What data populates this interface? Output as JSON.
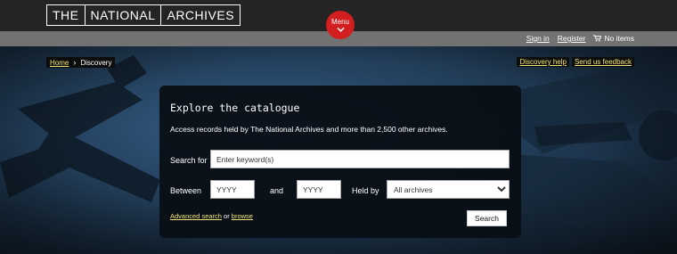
{
  "header": {
    "logo": [
      "THE",
      "NATIONAL",
      "ARCHIVES"
    ],
    "menu_label": "Menu"
  },
  "userbar": {
    "sign_in": "Sign in",
    "register": "Register",
    "cart": "No items"
  },
  "breadcrumb": {
    "home": "Home",
    "current": "Discovery"
  },
  "help_links": {
    "discovery_help": "Discovery help",
    "feedback": "Send us feedback"
  },
  "search_panel": {
    "title": "Explore the catalogue",
    "intro": "Access records held by The National Archives and more than 2,500 other archives.",
    "search_label": "Search for",
    "search_placeholder": "Enter keyword(s)",
    "between_label": "Between",
    "from_placeholder": "YYYY",
    "and_label": "and",
    "to_placeholder": "YYYY",
    "held_by_label": "Held by",
    "held_by_selected": "All archives",
    "advanced_search": "Advanced search",
    "or_text": " or ",
    "browse": "browse",
    "search_button": "Search"
  },
  "colors": {
    "topbar": "#242424",
    "userbar": "#727272",
    "menu_button": "#d21e1e",
    "link_yellow": "#f3e37a",
    "panel": "#080e14"
  }
}
